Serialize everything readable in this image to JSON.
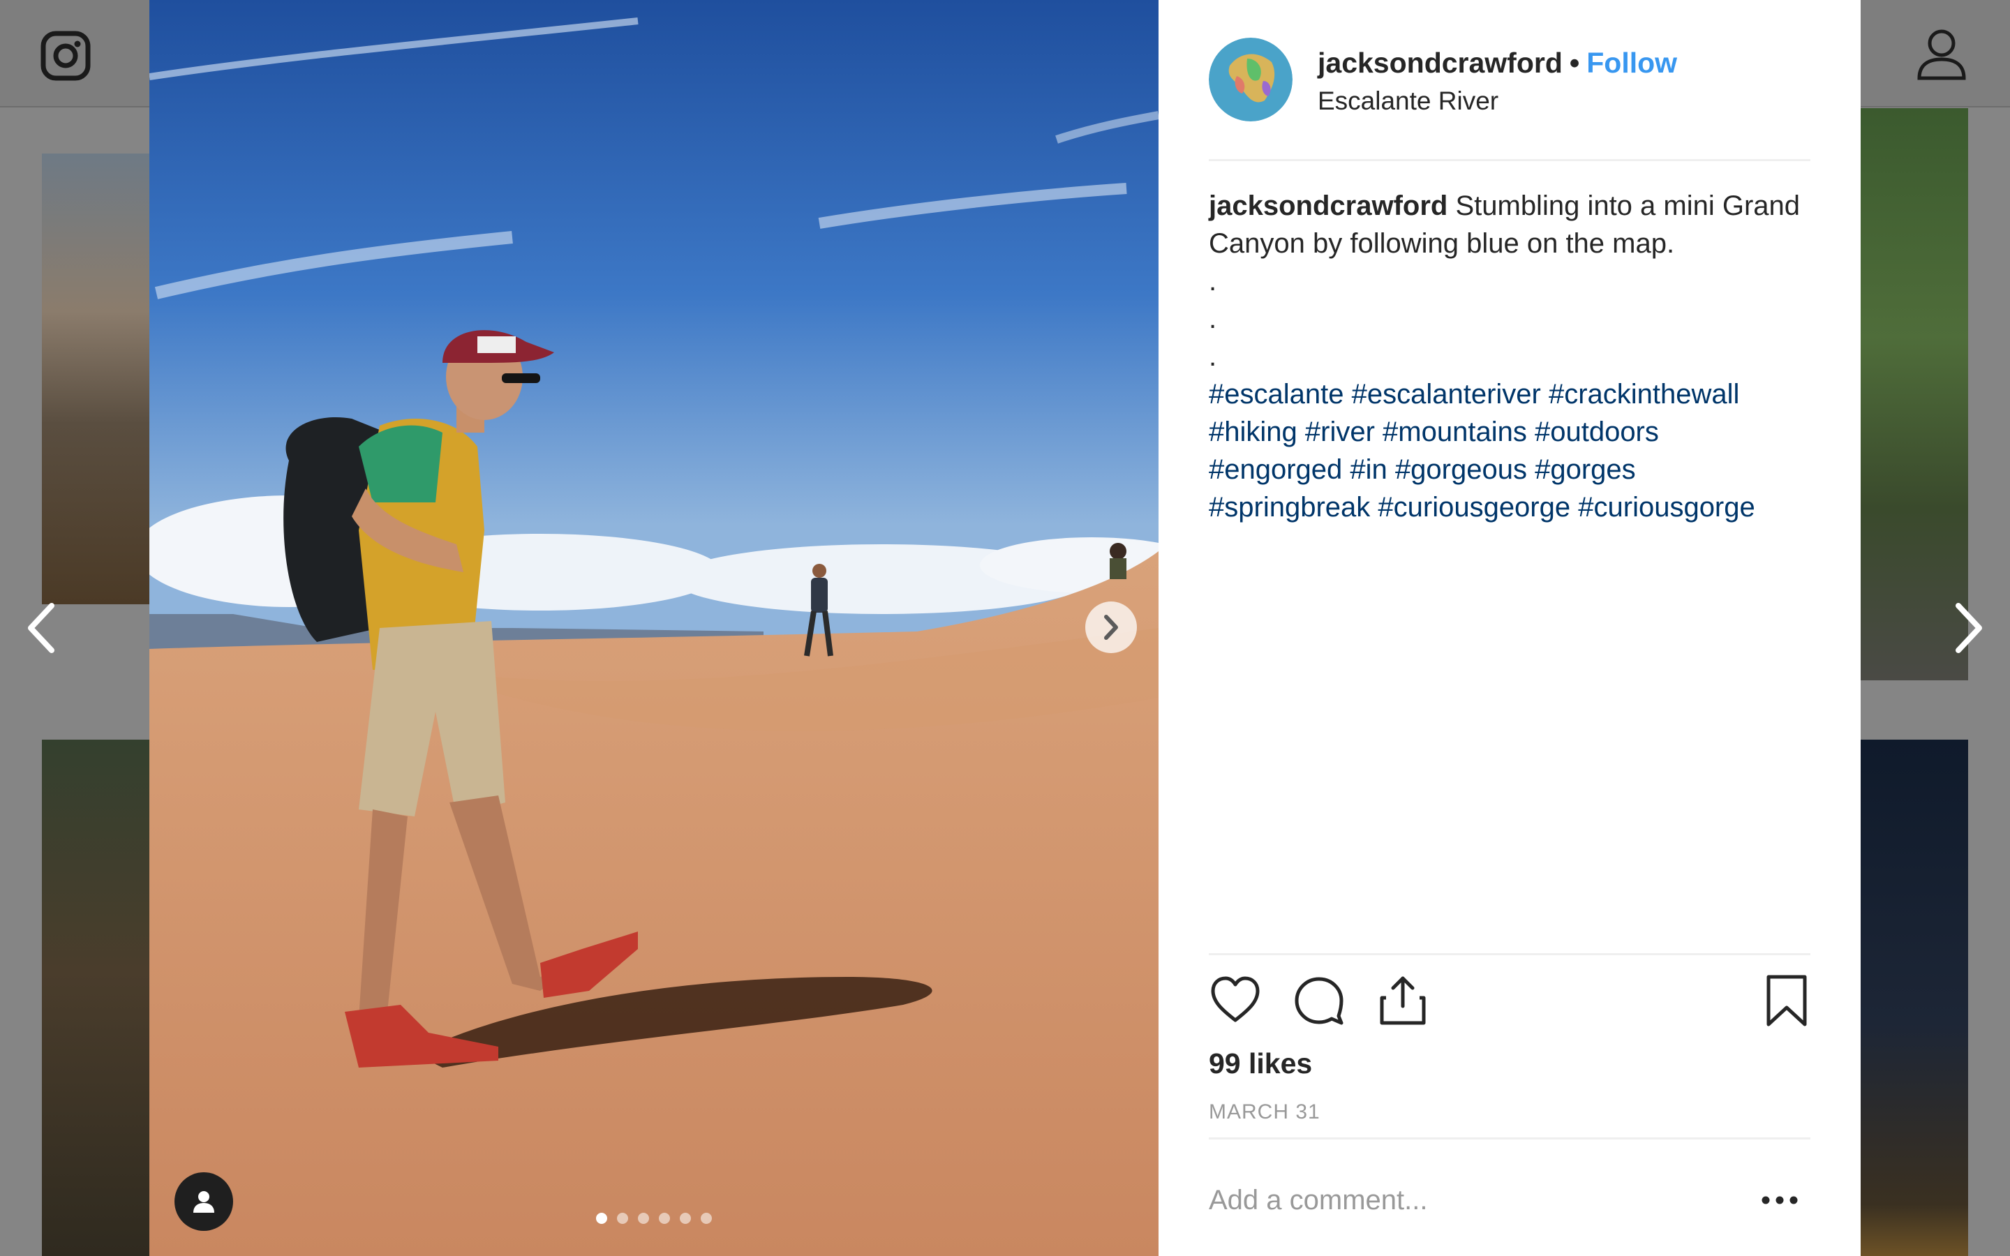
{
  "post": {
    "username": "jacksondcrawford",
    "separator": "•",
    "follow_label": "Follow",
    "location": "Escalante River",
    "caption": {
      "username": "jacksondcrawford",
      "lines": [
        "Stumbling into a mini Grand",
        "Canyon by following blue on the map.",
        ".",
        ".",
        "."
      ],
      "hashtag_lines": [
        [
          "#escalante",
          "#escalanteriver",
          "#crackinthewall"
        ],
        [
          "#hiking",
          "#river",
          "#mountains",
          "#outdoors"
        ],
        [
          "#engorged",
          "#in",
          "#gorgeous",
          "#gorges"
        ],
        [
          "#springbreak",
          "#curiousgeorge",
          "#curiousgorge"
        ]
      ]
    },
    "likes": "99 likes",
    "date": "MARCH 31",
    "comment_placeholder": "Add a comment...",
    "carousel": {
      "count": 6,
      "active_index": 0
    }
  },
  "icons": {
    "logo": "instagram-icon",
    "profile": "profile-icon",
    "prev": "chevron-left-icon",
    "next": "chevron-right-icon",
    "like": "heart-icon",
    "comment": "comment-icon",
    "share": "share-icon",
    "save": "bookmark-icon",
    "more": "more-icon",
    "tag": "user-tag-icon"
  },
  "colors": {
    "follow": "#3897f0",
    "hashtag": "#003569",
    "text": "#262626",
    "muted": "#999999"
  }
}
